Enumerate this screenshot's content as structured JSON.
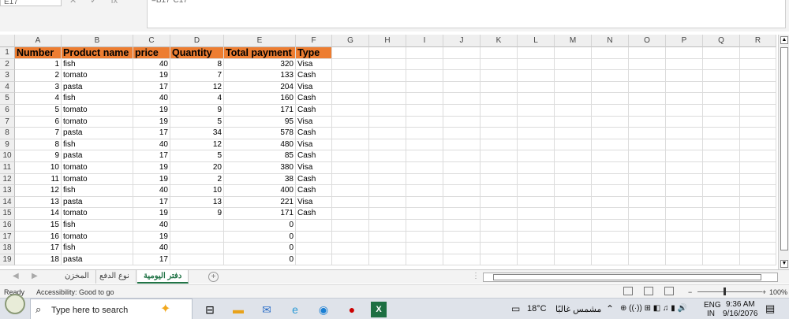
{
  "formula_bar": {
    "name_box": "E17",
    "cancel": "✕",
    "enter": "✓",
    "fx": "fx",
    "formula": "=B17*C17"
  },
  "columns": [
    "A",
    "B",
    "C",
    "D",
    "E",
    "F",
    "G",
    "H",
    "I",
    "J",
    "K",
    "L",
    "M",
    "N",
    "O",
    "P",
    "Q",
    "R"
  ],
  "row_numbers": [
    "1",
    "2",
    "3",
    "4",
    "5",
    "6",
    "7",
    "8",
    "9",
    "10",
    "11",
    "12",
    "13",
    "14",
    "15",
    "16",
    "17",
    "18",
    "19"
  ],
  "header_row": [
    "Number",
    "Product name",
    "price",
    "Quantity",
    "Total payment",
    "Type"
  ],
  "rows": [
    [
      "1",
      "fish",
      "40",
      "8",
      "320",
      "Visa"
    ],
    [
      "2",
      "tomato",
      "19",
      "7",
      "133",
      "Cash"
    ],
    [
      "3",
      "pasta",
      "17",
      "12",
      "204",
      "Visa"
    ],
    [
      "4",
      "fish",
      "40",
      "4",
      "160",
      "Cash"
    ],
    [
      "5",
      "tomato",
      "19",
      "9",
      "171",
      "Cash"
    ],
    [
      "6",
      "tomato",
      "19",
      "5",
      "95",
      "Visa"
    ],
    [
      "7",
      "pasta",
      "17",
      "34",
      "578",
      "Cash"
    ],
    [
      "8",
      "fish",
      "40",
      "12",
      "480",
      "Visa"
    ],
    [
      "9",
      "pasta",
      "17",
      "5",
      "85",
      "Cash"
    ],
    [
      "10",
      "tomato",
      "19",
      "20",
      "380",
      "Visa"
    ],
    [
      "11",
      "tomato",
      "19",
      "2",
      "38",
      "Cash"
    ],
    [
      "12",
      "fish",
      "40",
      "10",
      "400",
      "Cash"
    ],
    [
      "13",
      "pasta",
      "17",
      "13",
      "221",
      "Visa"
    ],
    [
      "14",
      "tomato",
      "19",
      "9",
      "171",
      "Cash"
    ],
    [
      "15",
      "fish",
      "40",
      "",
      "0",
      ""
    ],
    [
      "16",
      "tomato",
      "19",
      "",
      "0",
      ""
    ],
    [
      "17",
      "fish",
      "40",
      "",
      "0",
      ""
    ],
    [
      "18",
      "pasta",
      "17",
      "",
      "0",
      ""
    ]
  ],
  "header_color": "#ed7d31",
  "sheet_tabs": [
    {
      "label": "المخزن",
      "active": false
    },
    {
      "label": "نوع الدفع",
      "active": false
    },
    {
      "label": "دفتر اليومية",
      "active": true
    }
  ],
  "add_sheet": "+",
  "status": {
    "ready": "Ready",
    "accessibility": "Accessibility: Good to go",
    "zoom_minus": "−",
    "zoom_plus": "+",
    "zoom": "100%"
  },
  "taskbar": {
    "search_placeholder": "Type here to search",
    "weather_temp": "18°C",
    "weather_text": "مشمس غالبًا",
    "lang_top": "ENG",
    "lang_bottom": "IN",
    "time": "9:36 AM",
    "date": "9/16/2076"
  }
}
